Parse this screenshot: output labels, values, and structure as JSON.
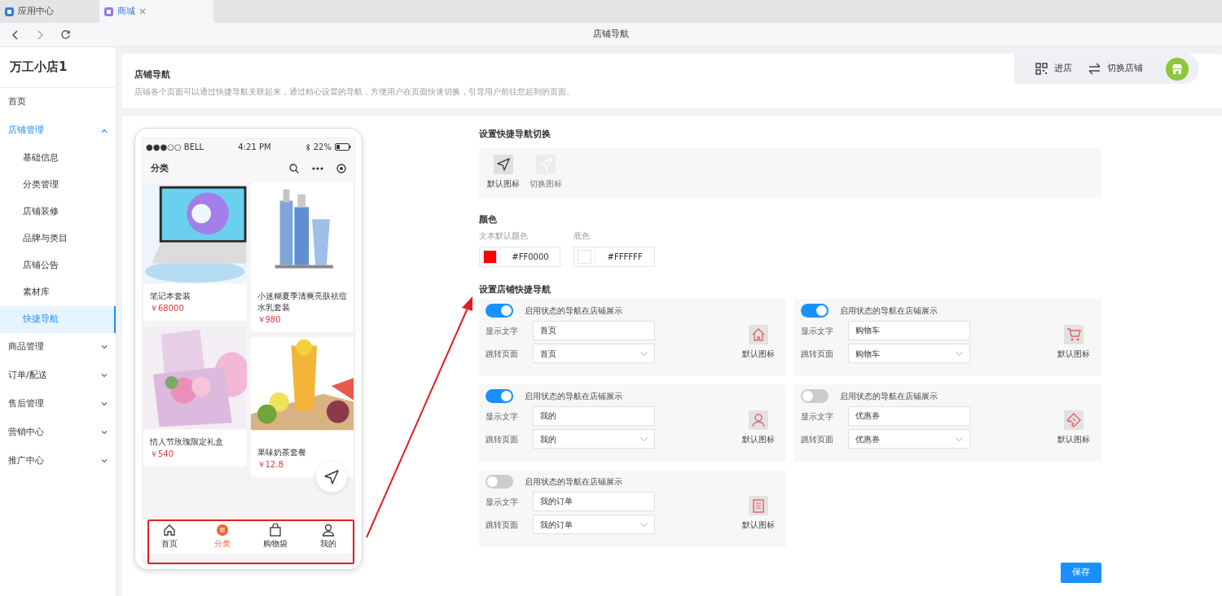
{
  "browser_tabs": [
    {
      "label": "应用中心",
      "selected": false
    },
    {
      "label": "商城",
      "selected": true
    }
  ],
  "page_title": "店铺导航",
  "sidebar": {
    "shop_name": "万工小店1",
    "items": [
      {
        "label": "首页",
        "kind": "link",
        "expanded": false,
        "selected": false
      },
      {
        "label": "店铺管理",
        "kind": "group",
        "expanded": true,
        "selected": false,
        "children": [
          {
            "label": "基础信息",
            "selected": false
          },
          {
            "label": "分类管理",
            "selected": false
          },
          {
            "label": "店铺装修",
            "selected": false
          },
          {
            "label": "品牌与类目",
            "selected": false
          },
          {
            "label": "店铺公告",
            "selected": false
          },
          {
            "label": "素材库",
            "selected": false
          },
          {
            "label": "快捷导航",
            "selected": true
          }
        ]
      },
      {
        "label": "商品管理",
        "kind": "group",
        "expanded": false,
        "selected": false
      },
      {
        "label": "订单/配送",
        "kind": "group",
        "expanded": false,
        "selected": false
      },
      {
        "label": "售后管理",
        "kind": "group",
        "expanded": false,
        "selected": false
      },
      {
        "label": "营销中心",
        "kind": "group",
        "expanded": false,
        "selected": false
      },
      {
        "label": "推广中心",
        "kind": "group",
        "expanded": false,
        "selected": false
      }
    ]
  },
  "header": {
    "title": "店铺导航",
    "description": "店铺各个页面可以通过快捷导航关联起来，通过精心设置的导航，方便用户在页面快速切换，引导用户前往您起到的页面。"
  },
  "toolbar": [
    {
      "label": "进店",
      "kind": "qr"
    },
    {
      "label": "切换店铺",
      "kind": "swap"
    }
  ],
  "phone": {
    "carrier": "●●●○○ BELL",
    "time": "4:21 PM",
    "battery": "22%",
    "title": "分类",
    "products": [
      {
        "name": "笔记本套装",
        "price": "￥68000",
        "kind": "laptop"
      },
      {
        "name": "小迷糊夏季清爽亮肤祛痘水乳套装",
        "price": "￥980",
        "kind": "bottles"
      },
      {
        "name": "情人节玫瑰限定礼盒",
        "price": "￥540",
        "kind": "giftbox"
      },
      {
        "name": "果味奶茶套餐",
        "price": "￥12.8",
        "kind": "drink"
      }
    ],
    "tabbar": [
      {
        "label": "首页",
        "kind": "home",
        "selected": false
      },
      {
        "label": "分类",
        "kind": "category",
        "selected": true
      },
      {
        "label": "购物袋",
        "kind": "bag",
        "selected": false
      },
      {
        "label": "我的",
        "kind": "user",
        "selected": false
      }
    ]
  },
  "nav_switch": {
    "title": "设置快捷导航切换",
    "options": [
      {
        "label": "默认图标",
        "selected": true
      },
      {
        "label": "切换图标",
        "selected": false
      }
    ]
  },
  "colors": {
    "title": "颜色",
    "fields": [
      {
        "label": "文本默认颜色",
        "value": "#FF0000",
        "color": "#ff0000"
      },
      {
        "label": "底色",
        "value": "#FFFFFF",
        "color": "#ffffff"
      }
    ]
  },
  "quick_nav": {
    "title": "设置店铺快捷导航",
    "items": [
      {
        "enabled": true,
        "toggle_label": "启用状态的导航在店铺展示",
        "text_label": "显示文字",
        "text_value": "首页",
        "page_label": "跳转页面",
        "page_value": "首页",
        "icon_label": "默认图标",
        "kind": "home"
      },
      {
        "enabled": true,
        "toggle_label": "启用状态的导航在店铺展示",
        "text_label": "显示文字",
        "text_value": "购物车",
        "page_label": "跳转页面",
        "page_value": "购物车",
        "icon_label": "默认图标",
        "kind": "cart"
      },
      {
        "enabled": true,
        "toggle_label": "启用状态的导航在店铺展示",
        "text_label": "显示文字",
        "text_value": "我的",
        "page_label": "跳转页面",
        "page_value": "我的",
        "icon_label": "默认图标",
        "kind": "user"
      },
      {
        "enabled": false,
        "toggle_label": "启用状态的导航在店铺展示",
        "text_label": "显示文字",
        "text_value": "优惠券",
        "page_label": "跳转页面",
        "page_value": "优惠券",
        "icon_label": "默认图标",
        "kind": "coupon"
      },
      {
        "enabled": false,
        "toggle_label": "启用状态的导航在店铺展示",
        "text_label": "显示文字",
        "text_value": "我的订单",
        "page_label": "跳转页面",
        "page_value": "我的订单",
        "icon_label": "默认图标",
        "kind": "order"
      }
    ]
  },
  "save_button": "保存"
}
